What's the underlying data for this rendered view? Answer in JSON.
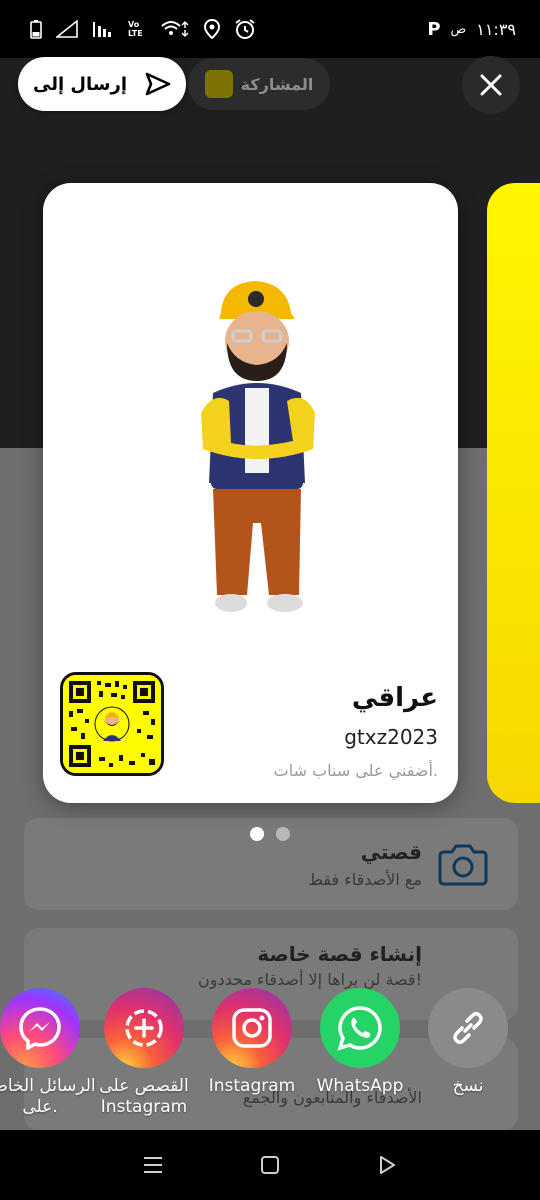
{
  "status_bar": {
    "time": "١١:٣٩",
    "am_pm": "ص",
    "carrier_badge": "P",
    "volte": "Vo LTE"
  },
  "header": {
    "send_to_label": "إرسال إلى",
    "share_label": "المشاركة"
  },
  "profile_card": {
    "display_name": "عراقي",
    "username": "gtxz2023",
    "tagline": "أضفني على سناب شات."
  },
  "background_page": {
    "item_1_title": "قصتي",
    "item_1_subtitle": "مع الأصدقاء فقط",
    "item_2_title": "إنشاء قصة خاصة",
    "item_2_subtitle": "قصة لن يراها إلا أصدقاء محددون!",
    "item_3_subtitle": "الأصدقاء والمتابعون والجمع"
  },
  "share_targets": [
    {
      "label": "الرسائل الخاصة على.",
      "icon": "messenger-icon"
    },
    {
      "label": "القصص على Instagram",
      "icon": "instagram-stories-icon"
    },
    {
      "label": "Instagram",
      "icon": "instagram-icon"
    },
    {
      "label": "WhatsApp",
      "icon": "whatsapp-icon"
    },
    {
      "label": "نسخ",
      "icon": "link-icon"
    }
  ],
  "colors": {
    "snap_yellow": "#fffc00",
    "whatsapp_green": "#25d366"
  }
}
